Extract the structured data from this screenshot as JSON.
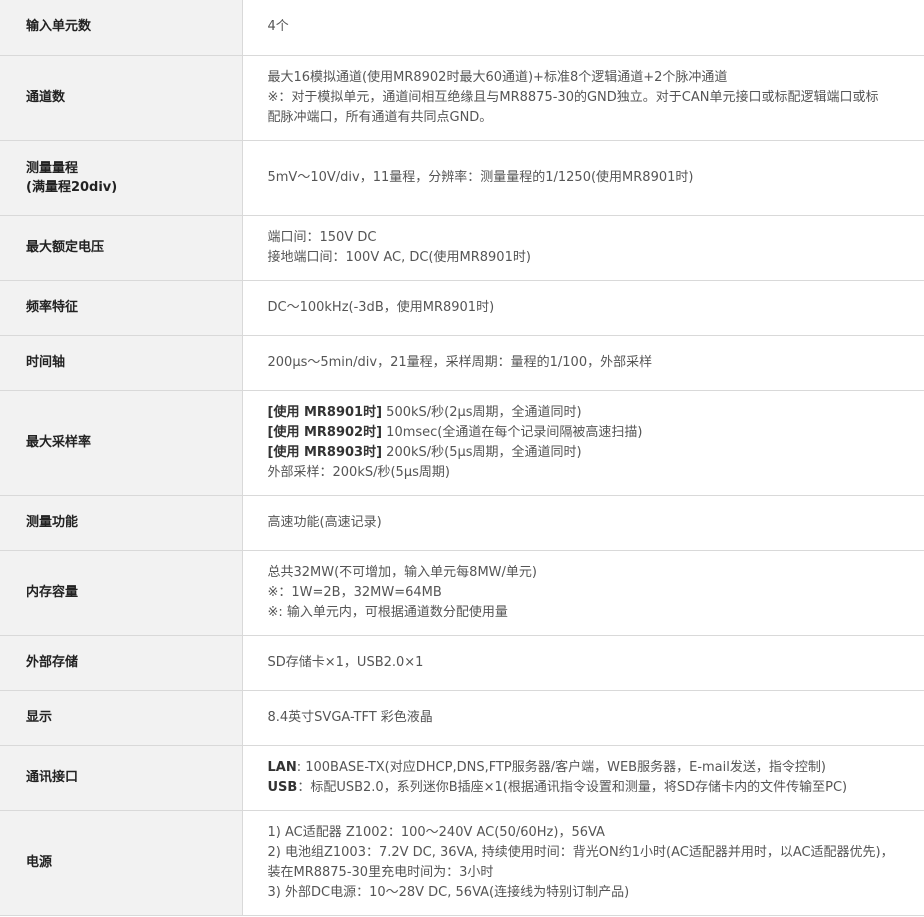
{
  "rows": [
    {
      "label": "输入单元数",
      "lines": [
        "4个"
      ]
    },
    {
      "label": "通道数",
      "lines": [
        "最大16模拟通道(使用MR8902时最大60通道)+标准8个逻辑通道+2个脉冲通道",
        "※：对于模拟单元，通道间相互绝缘且与MR8875-30的GND独立。对于CAN单元接口或标配逻辑端口或标",
        "配脉冲端口，所有通道有共同点GND。"
      ]
    },
    {
      "label": "测量量程",
      "sublabel": "(满量程20div)",
      "lines": [
        "5mV～10V/div，11量程，分辨率：测量量程的1/1250(使用MR8901时)"
      ]
    },
    {
      "label": "最大额定电压",
      "lines": [
        "端口间：150V DC",
        "接地端口间：100V AC, DC(使用MR8901时)"
      ]
    },
    {
      "label": "频率特征",
      "lines": [
        "DC～100kHz(-3dB，使用MR8901时)"
      ]
    },
    {
      "label": "时间轴",
      "lines": [
        "200μs～5min/div，21量程，采样周期：量程的1/100，外部采样"
      ]
    },
    {
      "label": "最大采样率",
      "lines": [
        {
          "bold": "[使用 MR8901时]",
          "text": " 500kS/秒(2μs周期，全通道同时)"
        },
        {
          "bold": "[使用 MR8902时]",
          "text": " 10msec(全通道在每个记录间隔被高速扫描)"
        },
        {
          "bold": "[使用 MR8903时]",
          "text": " 200kS/秒(5μs周期，全通道同时)"
        },
        "外部采样：200kS/秒(5μs周期)"
      ]
    },
    {
      "label": "测量功能",
      "lines": [
        "高速功能(高速记录)"
      ]
    },
    {
      "label": "内存容量",
      "lines": [
        "总共32MW(不可增加，输入单元每8MW/单元)",
        "※：1W=2B，32MW=64MB",
        "※: 输入单元内，可根据通道数分配使用量"
      ]
    },
    {
      "label": "外部存储",
      "lines": [
        "SD存储卡×1，USB2.0×1"
      ]
    },
    {
      "label": "显示",
      "lines": [
        "8.4英寸SVGA-TFT 彩色液晶"
      ]
    },
    {
      "label": "通讯接口",
      "lines": [
        {
          "bold": "LAN",
          "text": ": 100BASE-TX(对应DHCP,DNS,FTP服务器/客户端，WEB服务器，E-mail发送，指令控制)"
        },
        {
          "bold": "USB",
          "text": "：标配USB2.0，系列迷你B插座×1(根据通讯指令设置和测量，将SD存储卡内的文件传输至PC)"
        }
      ]
    },
    {
      "label": "电源",
      "lines": [
        "1) AC适配器 Z1002：100～240V AC(50/60Hz)，56VA",
        "2) 电池组Z1003：7.2V DC, 36VA, 持续使用时间：背光ON约1小时(AC适配器并用时，以AC适配器优先)，",
        "装在MR8875-30里充电时间为：3小时",
        "3) 外部DC电源：10～28V DC, 56VA(连接线为特别订制产品)"
      ]
    }
  ]
}
